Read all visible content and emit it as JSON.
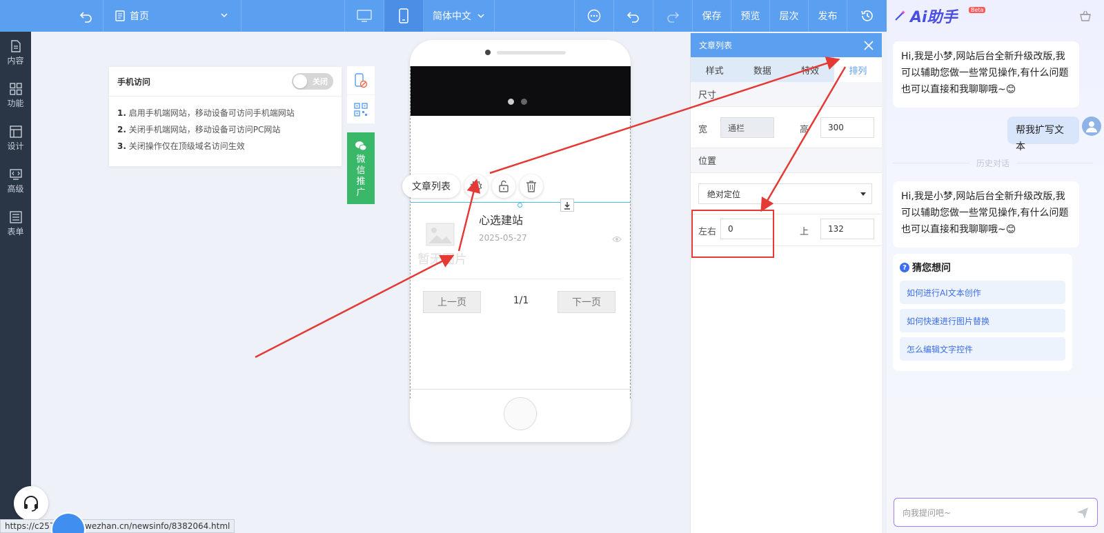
{
  "topbar": {
    "page_name": "首页",
    "language": "简体中文",
    "buttons": [
      "保存",
      "预览",
      "层次",
      "发布"
    ]
  },
  "leftnav": {
    "items": [
      {
        "label": "内容",
        "icon": "document-icon"
      },
      {
        "label": "功能",
        "icon": "grid-icon"
      },
      {
        "label": "设计",
        "icon": "layout-icon"
      },
      {
        "label": "高级",
        "icon": "code-icon"
      },
      {
        "label": "表单",
        "icon": "form-icon"
      }
    ]
  },
  "mobile_panel": {
    "title": "手机访问",
    "toggle_label": "关闭",
    "lines": [
      {
        "num": "1.",
        "text": "启用手机端网站，移动设备可访问手机端网站"
      },
      {
        "num": "2.",
        "text": "关闭手机端网站，移动设备可访问PC网站"
      },
      {
        "num": "3.",
        "text": "关闭操作仅在顶级域名访问生效"
      }
    ],
    "wechat_label": [
      "微",
      "信",
      "推",
      "广"
    ]
  },
  "phone": {
    "article_title": "心选建站",
    "article_date": "2025-05-27",
    "no_image_text": "暂无图片",
    "prev_label": "上一页",
    "page_indicator": "1/1",
    "next_label": "下一页"
  },
  "context_toolbar": {
    "label": "文章列表"
  },
  "properties": {
    "title": "文章列表",
    "tabs": [
      "样式",
      "数据",
      "特效",
      "排列"
    ],
    "active_tab": "排列",
    "size_section": "尺寸",
    "width_label": "宽",
    "width_value": "通栏",
    "height_label": "高",
    "height_value": "300",
    "position_section": "位置",
    "position_mode": "绝对定位",
    "left_right_label": "左右",
    "left_right_value": "0",
    "top_label": "上",
    "top_value": "132"
  },
  "ai_assistant": {
    "title": "Ai助手",
    "beta": "Beta",
    "greeting": "Hi,我是小梦,网站后台全新升级改版,我可以辅助您做一些常见操作,有什么问题也可以直接和我聊聊哦~😊",
    "user_message": "帮我扩写文本",
    "history_divider": "历史对话",
    "greeting_2": "Hi,我是小梦,网站后台全新升级改版,我可以辅助您做一些常见操作,有什么问题也可以直接和我聊聊哦~😊",
    "suggest_title": "猜您想问",
    "suggestions": [
      "如何进行AI文本创作",
      "如何快速进行图片替换",
      "怎么编辑文字控件"
    ],
    "input_placeholder": "向我提问吧~"
  },
  "status_url": "https://c257      sy.scd.wezhan.cn/newsinfo/8382064.html",
  "colors": {
    "topbar": "#5b9ff0",
    "sidebar": "#2a3546",
    "accent": "#5b9ff0",
    "wechat": "#3ab86a",
    "annotation_red": "#e53935"
  }
}
